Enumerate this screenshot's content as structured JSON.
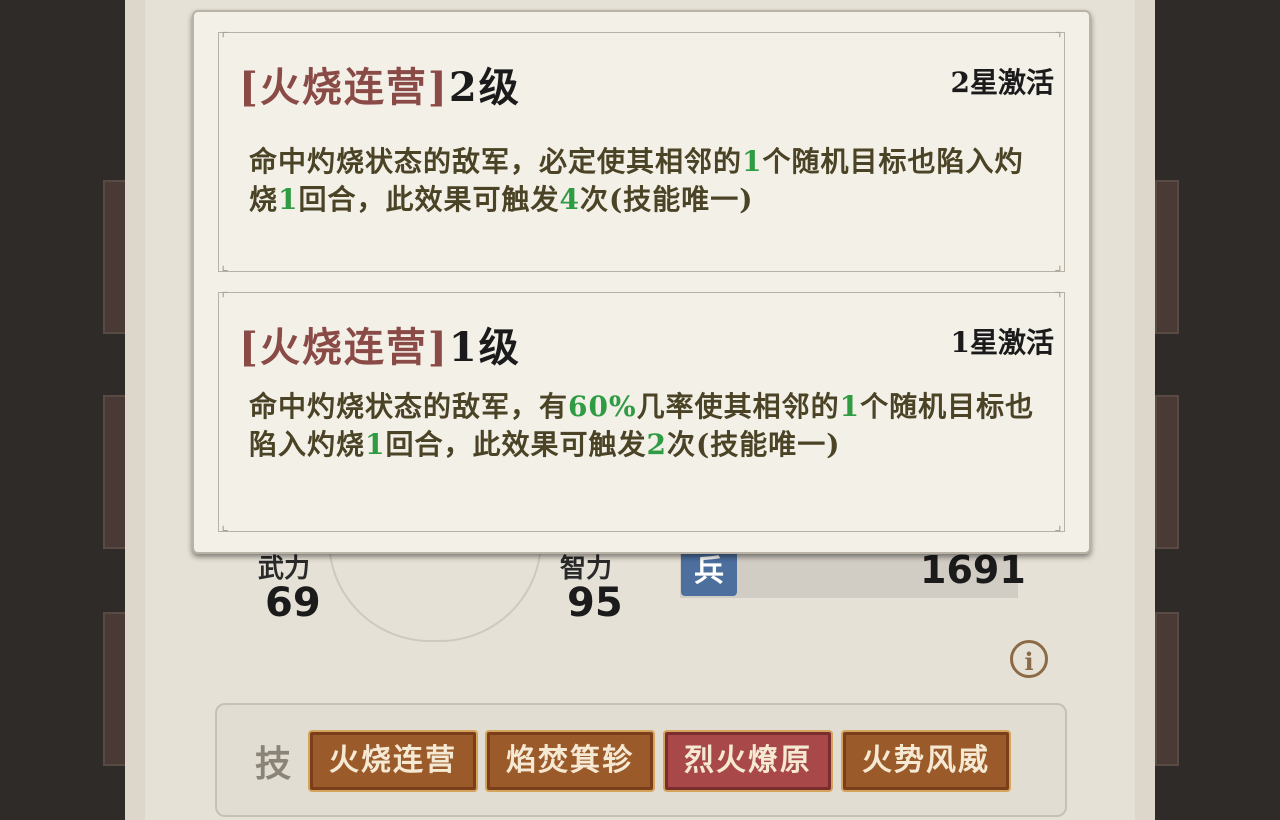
{
  "popup": {
    "skills": [
      {
        "name": "[火烧连营]",
        "level": "2级",
        "activation": "2星激活",
        "desc_parts": [
          "命中灼烧状态的敌军，必定使其相邻的",
          "1",
          "个随机目标也陷入灼烧",
          "1",
          "回合，此效果可触发",
          "4",
          "次(技能唯一)"
        ]
      },
      {
        "name": "[火烧连营]",
        "level": "1级",
        "activation": "1星激活",
        "desc_parts": [
          "命中灼烧状态的敌军，有",
          "60%",
          "几率使其相邻的",
          "1",
          "个随机目标也陷入灼烧",
          "1",
          "回合，此效果可触发",
          "2",
          "次(技能唯一)"
        ]
      }
    ]
  },
  "stats": {
    "force_label": "武力",
    "force_value": "69",
    "intel_label": "智力",
    "intel_value": "95"
  },
  "troops": {
    "icon_label": "兵",
    "count": "1691"
  },
  "info_icon": "i",
  "skill_bar": {
    "label": "技",
    "skills": [
      "火烧连营",
      "焰焚箕轸",
      "烈火燎原",
      "火势风威"
    ],
    "active_index": 2
  },
  "colors": {
    "highlight_number": "#2f9b42",
    "skill_name": "#8a4a46"
  }
}
